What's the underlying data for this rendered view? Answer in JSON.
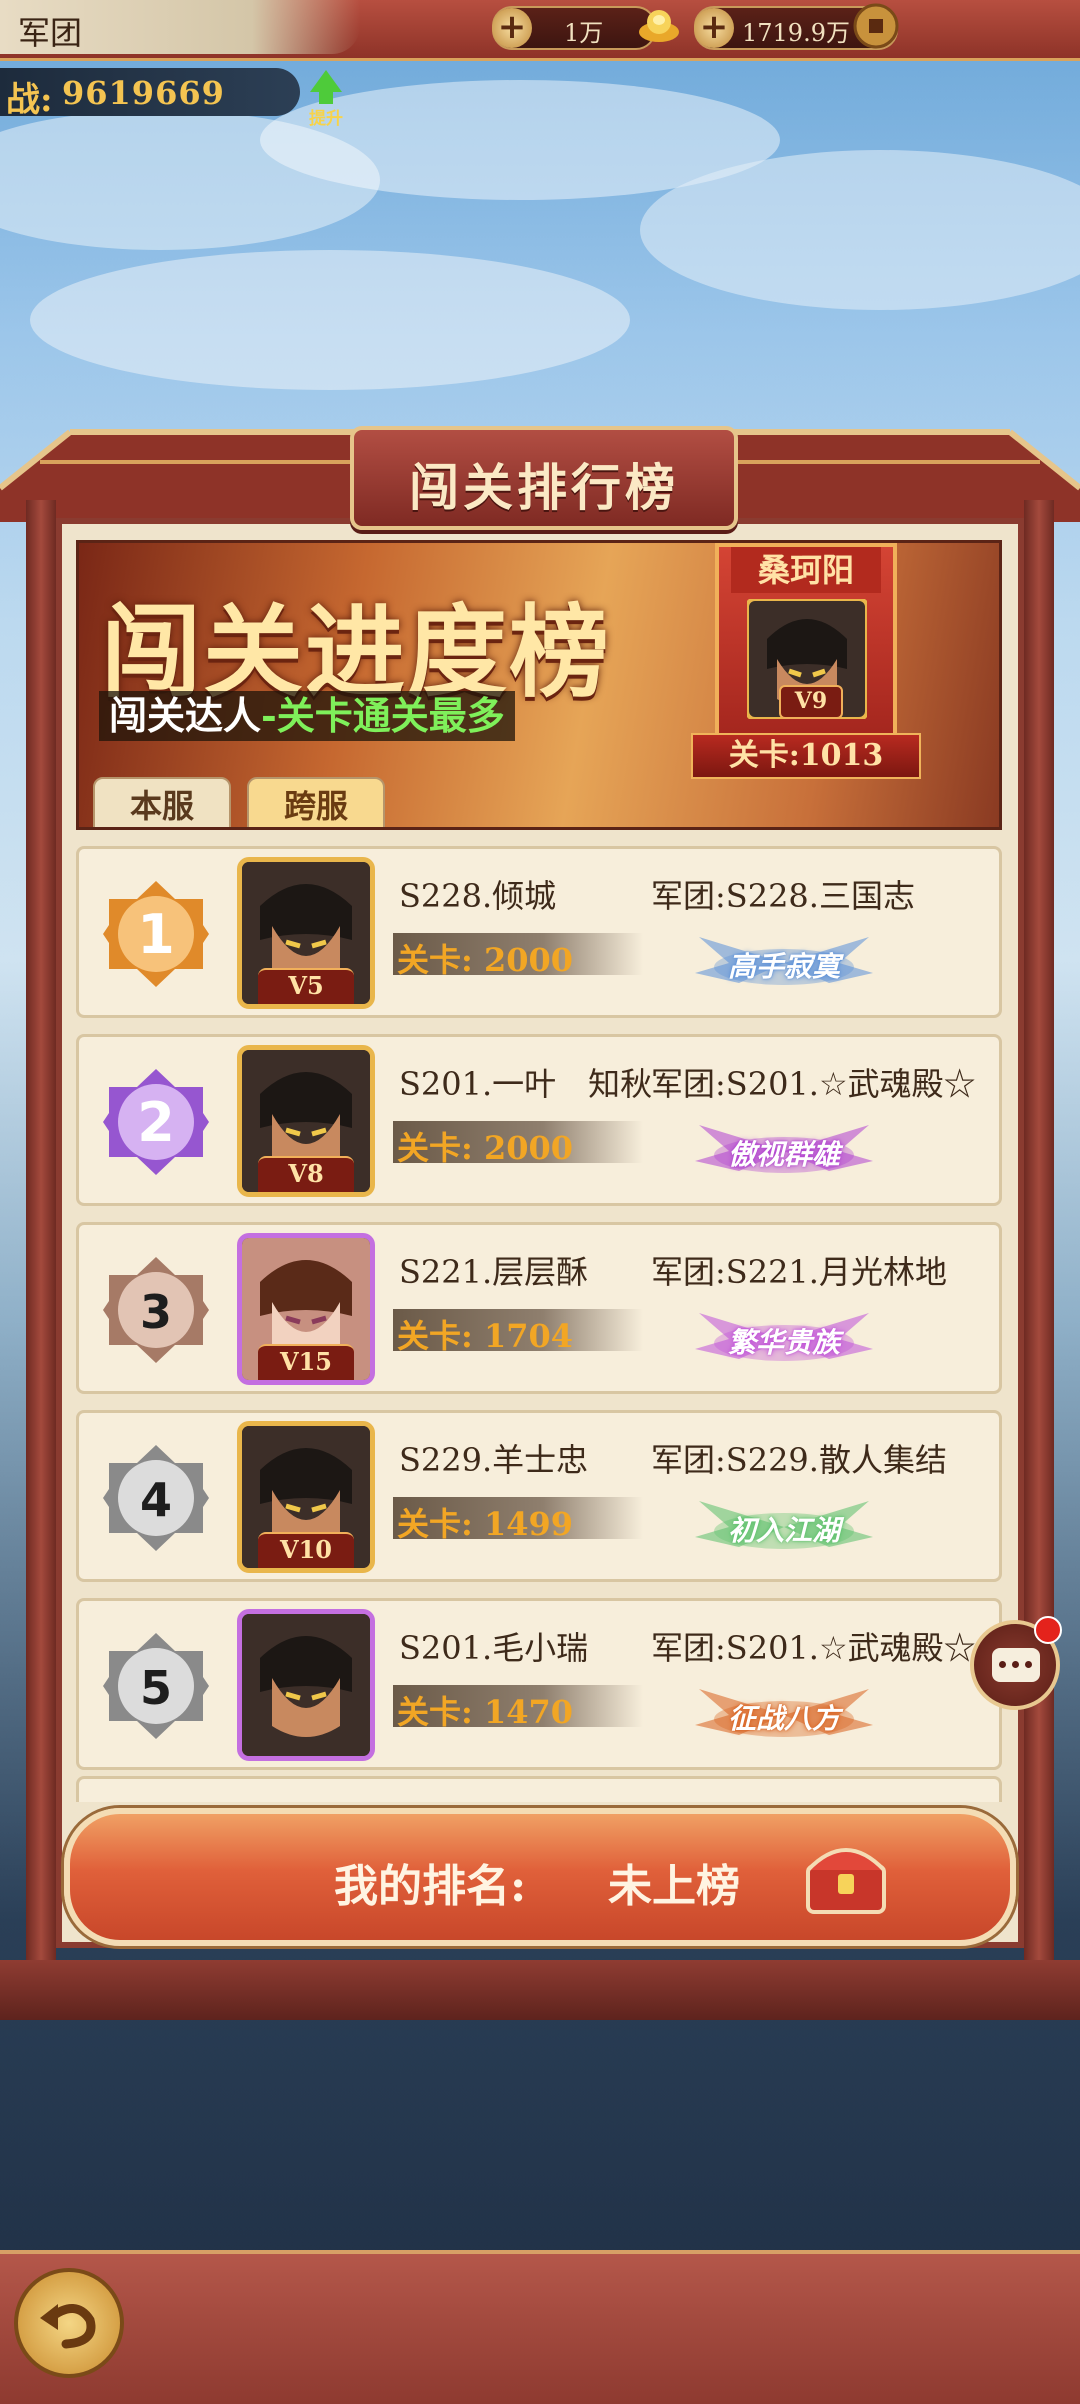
{
  "topbar": {
    "legion_label": "军团",
    "resource_1": "1万",
    "resource_2": "1719.9万"
  },
  "power": {
    "label": "战:",
    "value": "9619669",
    "boost_label": "提升"
  },
  "title": "闯关排行榜",
  "banner": {
    "big_title": "闯关进度榜",
    "subtitle_prefix": "闯关达人",
    "subtitle_highlight": "-关卡通关最多",
    "tabs": [
      {
        "label": "本服",
        "active": false
      },
      {
        "label": "跨服",
        "active": true
      }
    ],
    "champion": {
      "name": "桑珂阳",
      "vip": "V9",
      "stage": "关卡:1013"
    }
  },
  "ranks": [
    {
      "rank": "1",
      "name": "S228.倾城",
      "vip": "V5",
      "stage": "关卡: 2000",
      "legion": "军团:S228.三国志",
      "badge": "高手寂寞",
      "badge_color": "#5a8fd8"
    },
    {
      "rank": "2",
      "name": "S201.一叶　知秋",
      "vip": "V8",
      "stage": "关卡: 2000",
      "legion": "军团:S201.☆武魂殿☆",
      "badge": "傲视群雄",
      "badge_color": "#b040d0"
    },
    {
      "rank": "3",
      "name": "S221.层层酥",
      "vip": "V15",
      "stage": "关卡: 1704",
      "legion": "军团:S221.月光林地",
      "badge": "繁华贵族",
      "badge_color": "#c050d8"
    },
    {
      "rank": "4",
      "name": "S229.羊士忠",
      "vip": "V10",
      "stage": "关卡: 1499",
      "legion": "军团:S229.散人集结",
      "badge": "初入江湖",
      "badge_color": "#5ac06a"
    },
    {
      "rank": "5",
      "name": "S201.毛小瑞",
      "vip": "",
      "stage": "关卡: 1470",
      "legion": "军团:S201.☆武魂殿☆",
      "badge": "征战八方",
      "badge_color": "#d8601e"
    }
  ],
  "my_rank": {
    "label": "我的排名:",
    "value": "未上榜"
  },
  "colors": {
    "primary_red": "#8e3328",
    "gold": "#f4c451",
    "stage_orange": "#f2a624"
  }
}
